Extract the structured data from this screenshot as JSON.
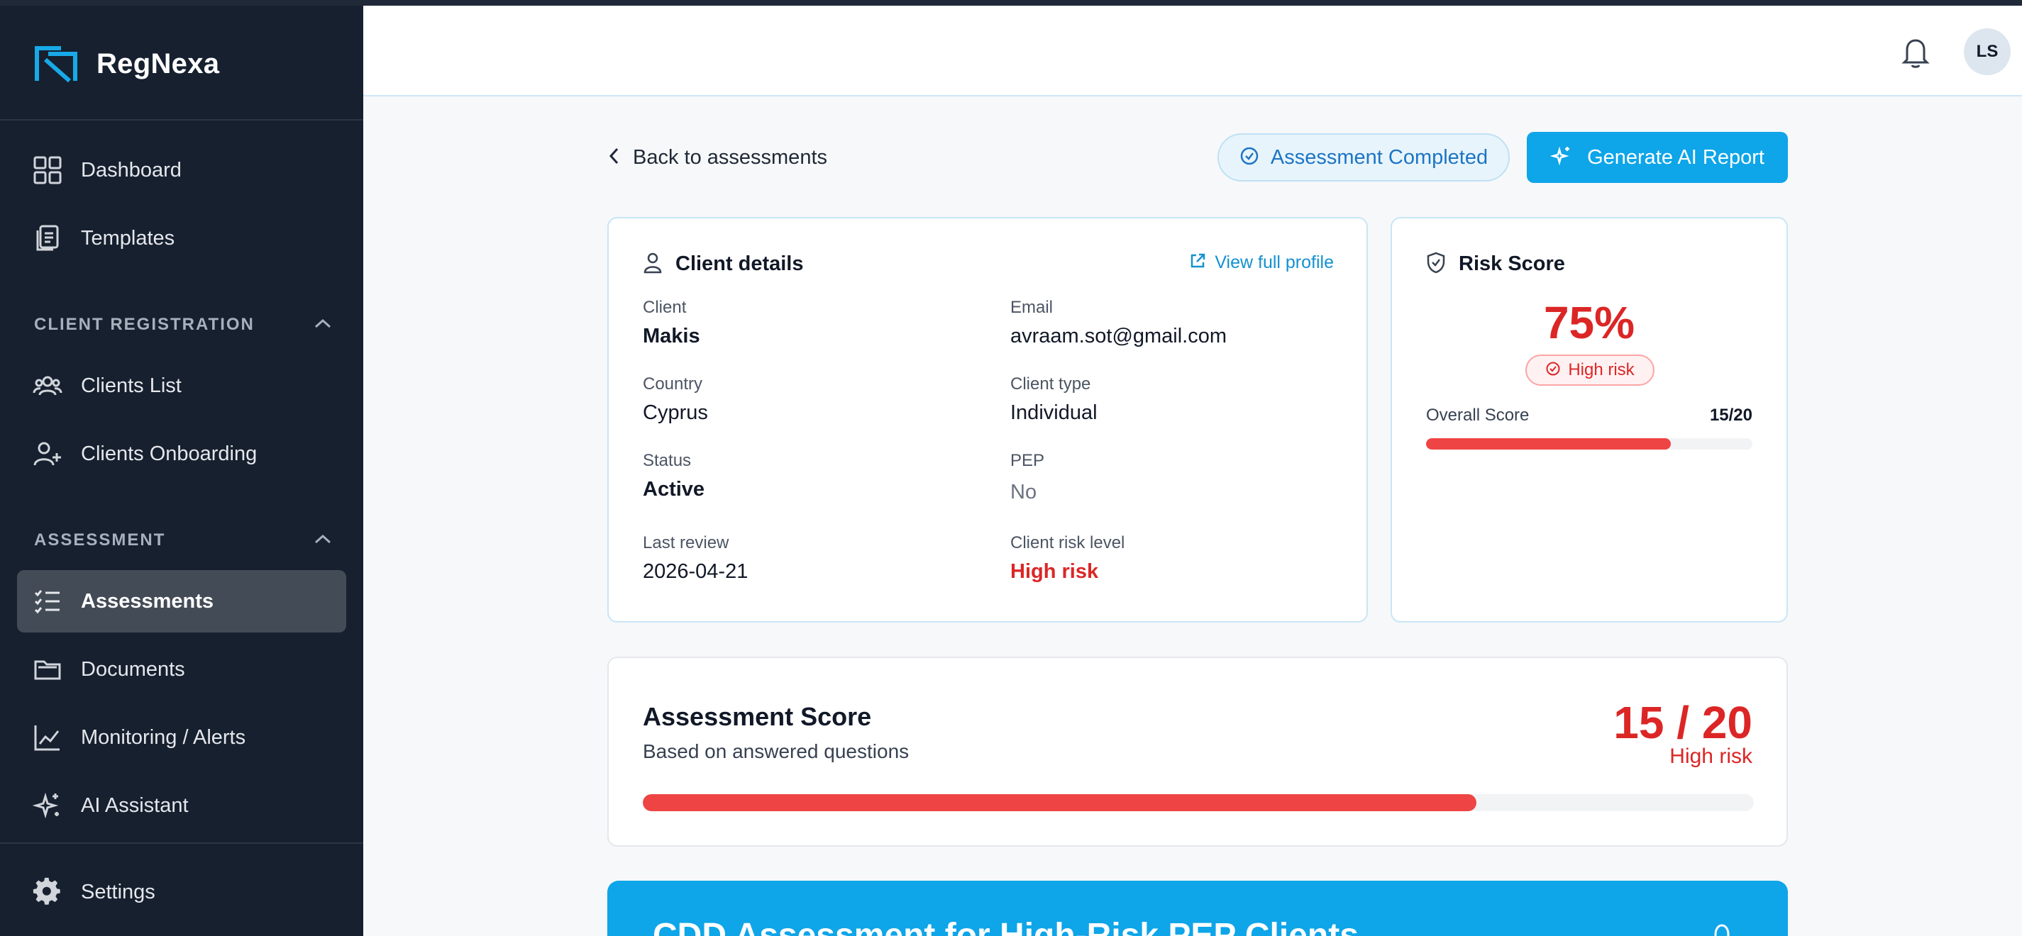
{
  "app": {
    "name": "RegNexa"
  },
  "sidebar": {
    "top_items": [
      {
        "label": "Dashboard",
        "icon": "grid-icon"
      },
      {
        "label": "Templates",
        "icon": "documents-icon"
      }
    ],
    "sections": [
      {
        "title": "CLIENT REGISTRATION",
        "items": [
          {
            "label": "Clients List",
            "icon": "users-icon"
          },
          {
            "label": "Clients Onboarding",
            "icon": "user-plus-icon"
          }
        ]
      },
      {
        "title": "ASSESSMENT",
        "items": [
          {
            "label": "Assessments",
            "icon": "checklist-icon",
            "active": true
          },
          {
            "label": "Documents",
            "icon": "folder-icon"
          },
          {
            "label": "Monitoring / Alerts",
            "icon": "chart-line-icon"
          },
          {
            "label": "AI Assistant",
            "icon": "sparkles-icon"
          }
        ]
      }
    ],
    "settings_label": "Settings"
  },
  "header": {
    "avatar_initials": "LS"
  },
  "toolbar": {
    "back_label": "Back to assessments",
    "status_label": "Assessment Completed",
    "ai_button_label": "Generate AI Report"
  },
  "client_details": {
    "title": "Client details",
    "view_profile_label": "View full profile",
    "fields": {
      "client": {
        "label": "Client",
        "value": "Makis"
      },
      "email": {
        "label": "Email",
        "value": "avraam.sot@gmail.com"
      },
      "country": {
        "label": "Country",
        "value": "Cyprus"
      },
      "client_type": {
        "label": "Client type",
        "value": "Individual"
      },
      "status": {
        "label": "Status",
        "value": "Active"
      },
      "pep": {
        "label": "PEP",
        "value": "No"
      },
      "last_review": {
        "label": "Last review",
        "value": "2026-04-21"
      },
      "risk_level": {
        "label": "Client risk level",
        "value": "High risk"
      }
    }
  },
  "risk_score": {
    "title": "Risk Score",
    "percent_text": "75%",
    "level": "High risk",
    "overall_label": "Overall Score",
    "overall_value": "15/20",
    "progress": 0.75
  },
  "assessment_score": {
    "title": "Assessment Score",
    "subtitle": "Based on answered questions",
    "score_text": "15 / 20",
    "level": "High risk",
    "progress": 0.75
  },
  "banner": {
    "title": "CDD Assessment for High-Risk PEP Clients"
  },
  "colors": {
    "accent": "#0ea5e9",
    "danger": "#dc2626",
    "sidebar": "#16202f"
  }
}
